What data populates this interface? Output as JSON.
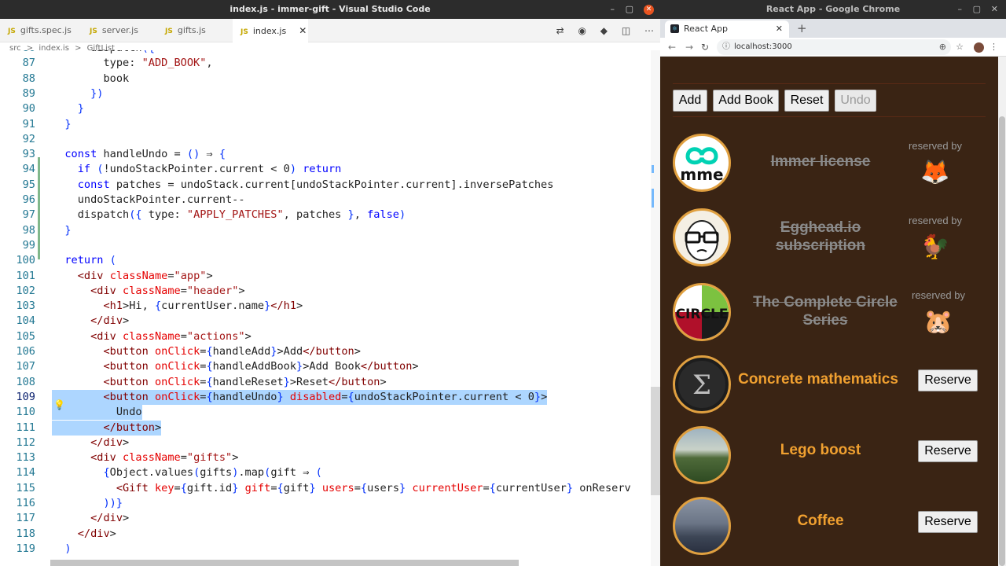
{
  "vscode": {
    "window_title": "index.js - immer-gift - Visual Studio Code",
    "tabs": [
      {
        "label": "gifts.spec.js",
        "badge": "JS"
      },
      {
        "label": "server.js",
        "badge": "JS"
      },
      {
        "label": "gifts.js",
        "badge": "JS"
      },
      {
        "label": "index.js",
        "badge": "JS",
        "close": "✕"
      }
    ],
    "breadcrumb": {
      "root": "src",
      "sep1": ">",
      "file": "index.js",
      "sep2": ">",
      "symbol": "GiftList"
    },
    "line_numbers": [
      "86",
      "87",
      "88",
      "89",
      "90",
      "91",
      "92",
      "93",
      "94",
      "95",
      "96",
      "97",
      "98",
      "99",
      "100",
      "101",
      "102",
      "103",
      "104",
      "105",
      "106",
      "107",
      "108",
      "109",
      "110",
      "111",
      "112",
      "113",
      "114",
      "115",
      "116",
      "117",
      "118",
      "119"
    ],
    "code_lines": [
      "    dispatch({",
      "      type: \"ADD_BOOK\",",
      "      book",
      "    })",
      "  }",
      "}",
      "",
      "const handleUndo = () ⇒ {",
      "  if (!undoStackPointer.current < 0) return",
      "  const patches = undoStack.current[undoStackPointer.current].inversePatches",
      "  undoStackPointer.current--",
      "  dispatch({ type: \"APPLY_PATCHES\", patches }, false)",
      "}",
      "",
      "return (",
      "  <div className=\"app\">",
      "    <div className=\"header\">",
      "      <h1>Hi, {currentUser.name}</h1>",
      "    </div>",
      "    <div className=\"actions\">",
      "      <button onClick={handleAdd}>Add</button>",
      "      <button onClick={handleAddBook}>Add Book</button>",
      "      <button onClick={handleReset}>Reset</button>",
      "      <button onClick={handleUndo} disabled={undoStackPointer.current < 0}>",
      "        Undo",
      "      </button>",
      "    </div>",
      "    <div className=\"gifts\">",
      "      {Object.values(gifts).map(gift ⇒ (",
      "        <Gift key={gift.id} gift={gift} users={users} currentUser={currentUser} onReserv",
      "      ))}",
      "    </div>",
      "  </div>",
      ")"
    ],
    "current_line": "109"
  },
  "chrome": {
    "window_title": "React App - Google Chrome",
    "tab_title": "React App",
    "tab_close": "✕",
    "new_tab": "+",
    "url": "localhost:3000",
    "actions": [
      {
        "label": "Add",
        "disabled": false
      },
      {
        "label": "Add Book",
        "disabled": false
      },
      {
        "label": "Reset",
        "disabled": false
      },
      {
        "label": "Undo",
        "disabled": true
      }
    ],
    "reserved_by_label": "reserved by",
    "reserve_label": "Reserve",
    "gifts": [
      {
        "title": "Immer license",
        "reserved": true,
        "reserver_icon": "fox-icon",
        "reserver_glyph": "🦊"
      },
      {
        "title": "Egghead.io subscription",
        "reserved": true,
        "reserver_icon": "chicken-icon",
        "reserver_glyph": "🐓"
      },
      {
        "title": "The Complete Circle Series",
        "reserved": true,
        "reserver_icon": "hamster-icon",
        "reserver_glyph": "🐹"
      },
      {
        "title": "Concrete mathematics",
        "reserved": false
      },
      {
        "title": "Lego boost",
        "reserved": false
      },
      {
        "title": "Coffee",
        "reserved": false
      }
    ],
    "colors": {
      "page_bg": "#3a2414",
      "accent": "#f0a030",
      "avatar_border": "#e0a040"
    }
  }
}
